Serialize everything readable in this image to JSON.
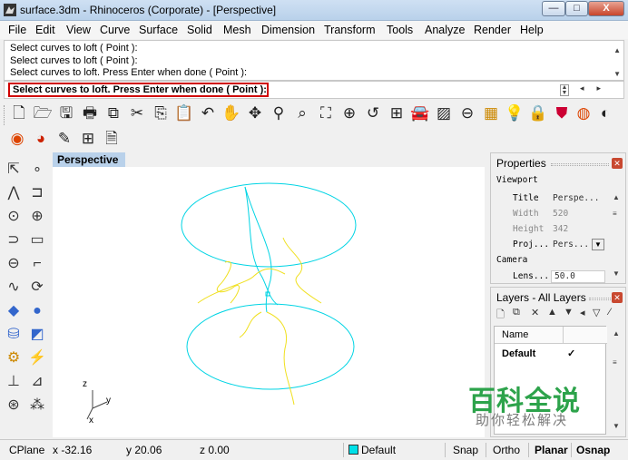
{
  "window": {
    "title": "surface.3dm - Rhinoceros (Corporate) - [Perspective]",
    "minimize_glyph": "—",
    "maximize_glyph": "□",
    "close_glyph": "X"
  },
  "menu": [
    "File",
    "Edit",
    "View",
    "Curve",
    "Surface",
    "Solid",
    "Mesh",
    "Dimension",
    "Transform",
    "Tools",
    "Analyze",
    "Render",
    "Help"
  ],
  "command_history": [
    "Select curves to loft ( Point ):",
    "Select curves to loft ( Point ):",
    "Select curves to loft. Press Enter when done ( Point ):"
  ],
  "command_prompt": "Select curves to loft. Press Enter when done ( Point ):",
  "toolbar_main_icons": [
    "new-file-icon",
    "open-folder-icon",
    "save-icon",
    "print-icon",
    "import-icon",
    "cut-icon",
    "copy-icon",
    "paste-icon",
    "undo-icon",
    "pan-hand-icon",
    "rotate-view-icon",
    "zoom-dynamic-icon",
    "zoom-window-icon",
    "zoom-extents-icon",
    "zoom-selected-icon",
    "undo-view-icon",
    "four-viewports-icon",
    "car-render-icon",
    "texture-icon",
    "snapshot-icon",
    "layer-props-icon",
    "lightbulb-icon",
    "lock-icon",
    "shield-icon",
    "render-sphere-icon",
    "half-sphere-icon"
  ],
  "toolbar_secondary_icons": [
    "shade-sphere-icon",
    "render-material-icon",
    "pencil-icon",
    "grid-options-icon",
    "document-props-icon"
  ],
  "left_toolbar_icons": [
    "select-arrow-icon",
    "point-icon",
    "polyline-icon",
    "curve-points-icon",
    "circle-icon",
    "arc-icon",
    "ellipse-icon",
    "rectangle-icon",
    "polygon-icon",
    "fillet-icon",
    "free-curve-icon",
    "offset-icon",
    "box-solid-icon",
    "sphere-solid-icon",
    "cylinder-icon",
    "surface-icon",
    "transform-gear-icon",
    "trim-icon",
    "boolean-icon",
    "array-icon",
    "dimension-icon",
    "text-icon"
  ],
  "viewport": {
    "label": "Perspective",
    "axis_labels": {
      "z": "z",
      "y": "y",
      "x": "x"
    }
  },
  "properties": {
    "title": "Properties",
    "section_viewport": "Viewport",
    "fields": [
      {
        "label": "Title",
        "value": "Perspe..."
      },
      {
        "label": "Width",
        "value": "520"
      },
      {
        "label": "Height",
        "value": "342"
      },
      {
        "label": "Proj...",
        "value": "Pers..."
      }
    ],
    "section_camera": "Camera",
    "lens_label": "Lens...",
    "lens_value": "50.0"
  },
  "layers": {
    "title": "Layers - All Layers",
    "column_name": "Name",
    "default_layer": "Default",
    "check": "✓"
  },
  "watermark": {
    "main": "百科全说",
    "sub": "助你轻松解决"
  },
  "status": {
    "cplane": "CPlane",
    "x": "x -32.16",
    "y": "y 20.06",
    "z": "z 0.00",
    "layer": "Default",
    "snap": "Snap",
    "ortho": "Ortho",
    "planar": "Planar",
    "osnap": "Osnap",
    "layer_color": "#00e0e8"
  },
  "colors": {
    "curve_cyan": "#00d4e4",
    "curve_yellow": "#f0e020",
    "prompt_border": "#d00000",
    "viewport_tab": "#b9d1ea"
  }
}
